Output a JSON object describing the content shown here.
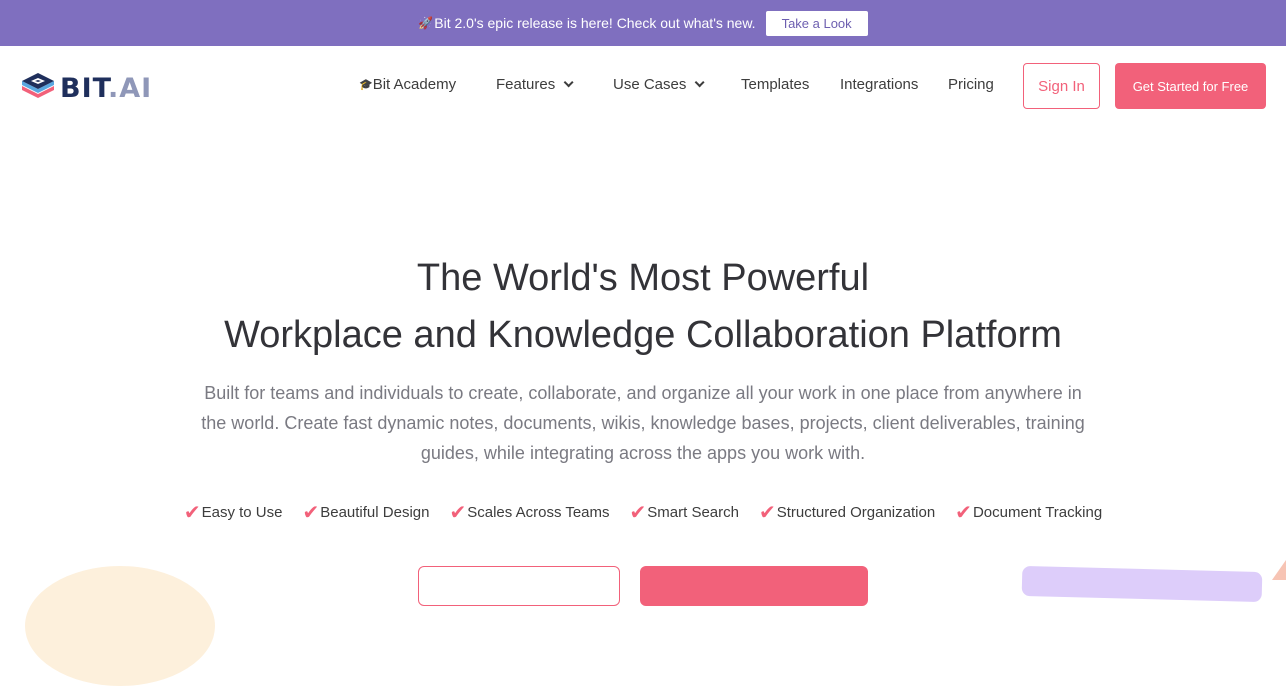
{
  "announcement": {
    "text": "Bit 2.0's epic release is here! Check out what's new.",
    "button_label": "Take a Look"
  },
  "brand": {
    "logo_main": "BIT",
    "logo_dot": ".",
    "logo_suffix": "AI"
  },
  "nav": {
    "items": [
      {
        "label": "Bit Academy",
        "icon": "graduation-cap-icon"
      },
      {
        "label": "Features",
        "dropdown": true
      },
      {
        "label": "Use Cases",
        "dropdown": true
      },
      {
        "label": "Templates"
      },
      {
        "label": "Integrations"
      },
      {
        "label": "Pricing"
      }
    ],
    "signin_label": "Sign In",
    "get_started_label": "Get Started for Free"
  },
  "hero": {
    "title_line1": "The World's Most Powerful",
    "title_line2": "Workplace and Knowledge Collaboration Platform",
    "description": "Built for teams and individuals to create, collaborate, and organize all your work in one place from anywhere in the world. Create fast dynamic notes, documents, wikis, knowledge bases, projects, client deliverables, training guides, while integrating across the apps you work with.",
    "features": [
      "Easy to Use",
      "Beautiful Design",
      "Scales Across Teams",
      "Smart Search",
      "Structured Organization",
      "Document Tracking"
    ]
  },
  "colors": {
    "announcement_bg": "#7f6fbf",
    "accent": "#f2617a",
    "logo_dark": "#1f2f5c",
    "logo_light": "#8f97b8"
  }
}
